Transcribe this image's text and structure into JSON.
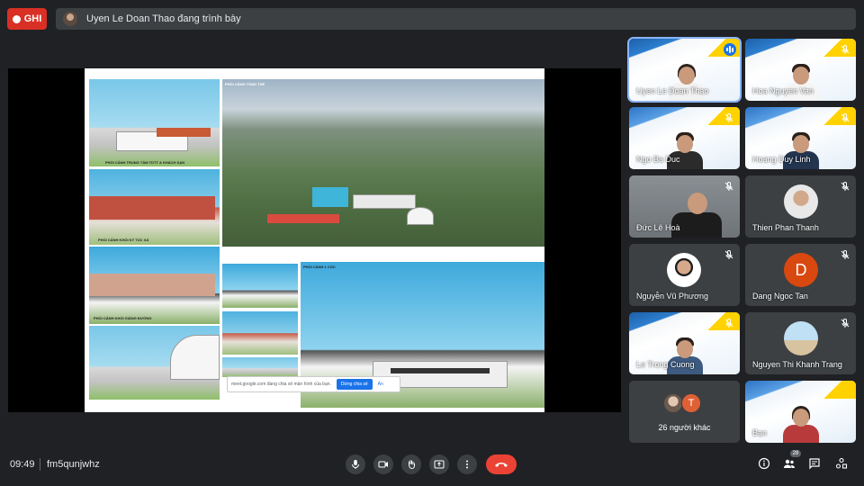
{
  "recording": {
    "label": "GHI"
  },
  "presenter_banner": {
    "text": "Uyen Le Doan Thao đang trình bày"
  },
  "slide": {
    "labels": {
      "top_main": "PHỐI CẢNH TỔNG THỂ",
      "left_1": "PHỐI CẢNH TRUNG TÂM TDTT & KHÁCH SẠN",
      "left_2": "PHỐI CẢNH KHỐI KÝ TÚC XÁ",
      "left_3": "PHỐI CẢNH KHỐI GIẢNG ĐƯỜNG",
      "bottom_main": "PHỐI CẢNH 1 CỐC"
    }
  },
  "share_bar": {
    "message": "meet.google.com đang chia sẻ màn hình của bạn.",
    "stop_label": "Dừng chia sẻ",
    "hide_label": "Ẩn"
  },
  "participants": [
    {
      "name": "Uyen Le Doan Thao",
      "style": "banner",
      "speaking": true
    },
    {
      "name": "Hoa Nguyen Van",
      "style": "banner",
      "muted": true
    },
    {
      "name": "Ngo Ba Duc",
      "style": "banner",
      "muted": true
    },
    {
      "name": "Hoang Duy Linh",
      "style": "banner",
      "muted": true
    },
    {
      "name": "Đức Lê Hoà",
      "style": "camera",
      "muted": true
    },
    {
      "name": "Thien Phan Thanh",
      "style": "avatar",
      "muted": true
    },
    {
      "name": "Nguyễn Vũ Phương",
      "style": "avatar",
      "muted": true
    },
    {
      "name": "Dang Ngoc Tan",
      "style": "letter",
      "letter": "D",
      "color": "#d9480f",
      "muted": true
    },
    {
      "name": "Le Trong Cuong",
      "style": "banner",
      "muted": true
    },
    {
      "name": "Nguyen Thi Khanh Trang",
      "style": "avatar",
      "muted": true
    },
    {
      "name": "26 người khác",
      "style": "others",
      "letter": "T"
    },
    {
      "name": "Bạn",
      "style": "banner"
    }
  ],
  "bottom_bar": {
    "time": "09:49",
    "meeting_code": "fm5qunjwhz",
    "participant_count": "28"
  },
  "icons": {
    "mic": "mic-icon",
    "camera": "camera-icon",
    "raise_hand": "hand-icon",
    "present": "present-icon",
    "more": "more-vert-icon",
    "end_call": "end-call-icon",
    "info": "info-icon",
    "people": "people-icon",
    "chat": "chat-icon",
    "activities": "activities-icon"
  },
  "colors": {
    "accent": "#8ab4f8",
    "danger": "#ea4335",
    "record": "#d93025",
    "share": "#1a73e8"
  }
}
